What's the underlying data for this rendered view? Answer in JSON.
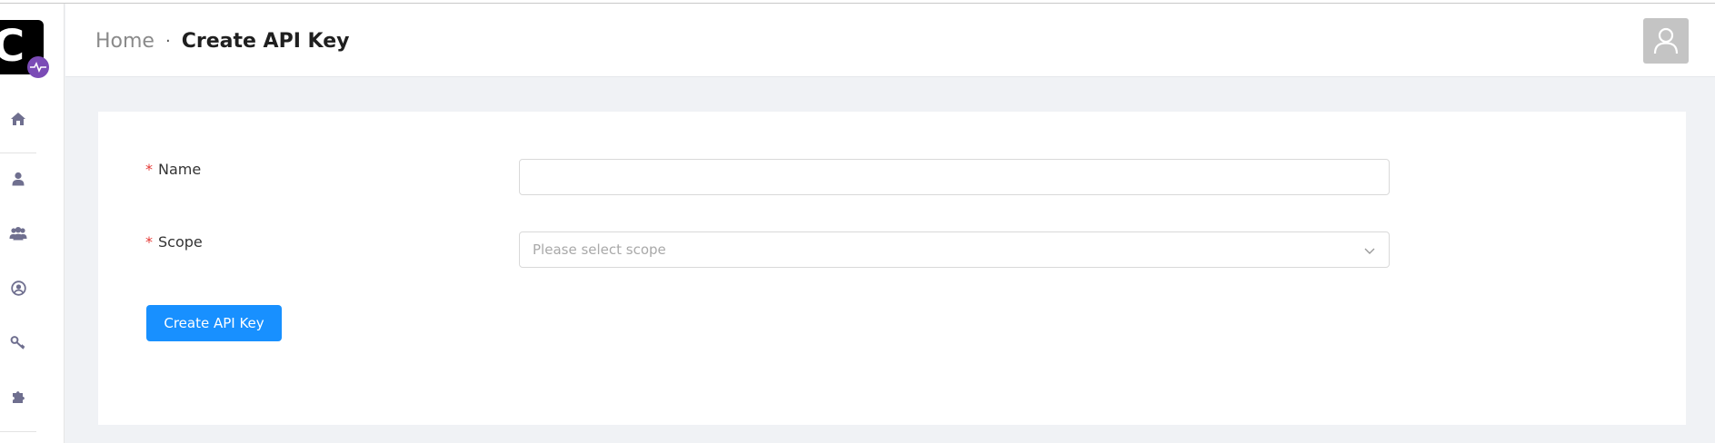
{
  "app": {
    "logo_text": "C"
  },
  "sidebar": {
    "items": [
      {
        "icon": "home-icon"
      },
      {
        "icon": "user-icon"
      },
      {
        "icon": "users-icon"
      },
      {
        "icon": "account-circle-icon"
      },
      {
        "icon": "key-icon"
      },
      {
        "icon": "puzzle-icon"
      }
    ]
  },
  "header": {
    "breadcrumb_home": "Home",
    "breadcrumb_separator": "·",
    "breadcrumb_current": "Create API Key"
  },
  "form": {
    "name_label": "Name",
    "name_required": "*",
    "name_value": "",
    "scope_label": "Scope",
    "scope_required": "*",
    "scope_placeholder": "Please select scope",
    "submit_label": "Create API Key"
  },
  "colors": {
    "primary": "#1890ff",
    "required": "#e53935",
    "logo_badge": "#7b4bb6"
  }
}
